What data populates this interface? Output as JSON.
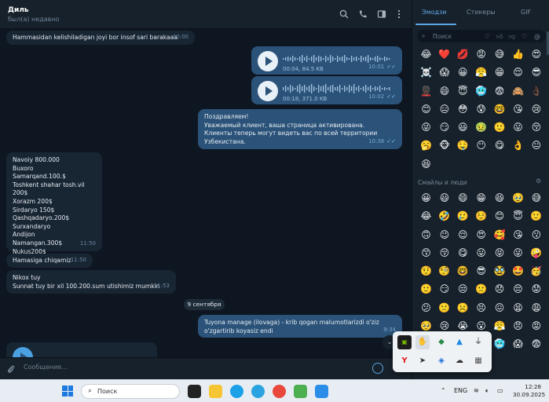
{
  "chat": {
    "name": "Диль",
    "status": "был(а) недавно",
    "composer_placeholder": "Сообщение..."
  },
  "messages": [
    {
      "text": "Hammasidan kelishiladigan joyi bor insof sari barakaaa",
      "time": "10:00"
    },
    {
      "voice_duration": "00:04, 84.5 KB",
      "time": "10:01"
    },
    {
      "voice_duration": "00:18, 371.0 KB",
      "time": "10:02"
    },
    {
      "lines": [
        "Поздравляем!",
        "Уважаемый клиент, ваша страница активирована.",
        "Клиенты теперь могут видеть вас по всей территории",
        "Узбекистана."
      ],
      "time": "10:38"
    },
    {
      "lines": [
        "Navoiy 800.000",
        "Buxoro",
        "Samarqand.100.$",
        "Toshkent shahar tosh.vil 200$",
        "Xorazm 200$",
        "Sirdaryo 150$",
        "Qashqadaryo.200$",
        "Surxandaryo",
        "Andijon",
        "Namangan.300$",
        "Nukus200$"
      ],
      "time": "11:50"
    },
    {
      "text": "Hamasiga chiqamiz",
      "time": "11:50"
    },
    {
      "lines": [
        "Nikox tuy",
        "Sunnat tuy bir xil 100.200.sum utishimiz mumkin"
      ],
      "time": "11:53"
    },
    {
      "lines": [
        "Tuyona manage (ilovaga) - krib qogan malumotlarizdi o'ziz",
        "o'zgartirib koyasiz endi"
      ],
      "time": "9:34"
    }
  ],
  "date_separator": "9 сентября",
  "emoji_panel": {
    "tabs": [
      "Эмодзи",
      "Стикеры",
      "GIF"
    ],
    "search_placeholder": "Поиск",
    "section_title": "Смайлы и люди",
    "recent": [
      "😂",
      "❤️",
      "💋",
      "😡",
      "😅",
      "👍",
      "😍",
      "☠️",
      "😱",
      "😀",
      "😤",
      "😁",
      "😌",
      "😎",
      "💂🏿",
      "😄",
      "😇",
      "🥶",
      "😨",
      "🙈",
      "👌🏿",
      "😊",
      "😑",
      "😳",
      "😰",
      "🤓",
      "😘",
      "😢",
      "😜",
      "😏",
      "😃",
      "🤢",
      "🙂",
      "😛",
      "😚",
      "🥱",
      "🐵",
      "🤤",
      "😶",
      "😋",
      "👌",
      "😐",
      "😆"
    ],
    "smileys": [
      "😀",
      "😃",
      "😄",
      "😁",
      "😆",
      "🥹",
      "😅",
      "😂",
      "🤣",
      "🥲",
      "☺️",
      "😊",
      "😇",
      "🙂",
      "🙃",
      "😉",
      "😌",
      "😍",
      "🥰",
      "😘",
      "😗",
      "😙",
      "😚",
      "😋",
      "😛",
      "😝",
      "😜",
      "🤪",
      "🤨",
      "🧐",
      "🤓",
      "😎",
      "🥸",
      "🤩",
      "🥳",
      "🙂",
      "😏",
      "😒",
      "🙁",
      "😞",
      "😔",
      "😟",
      "😕",
      "🙁",
      "☹️",
      "😣",
      "😖",
      "😫",
      "😩",
      "🥺",
      "😢",
      "😭",
      "😮",
      "😤",
      "😠",
      "😡",
      "🤬",
      "🤯",
      "😳",
      "🥵",
      "🥶",
      "😱",
      "😨",
      "😰",
      "😥"
    ]
  },
  "tray_popup": {
    "icons": [
      "nvidia-icon",
      "tray-app-icon",
      "stack-icon",
      "drive-icon",
      "usb-icon",
      "webcam-icon",
      "yandex-icon",
      "telegram-icon",
      "dropbox-icon",
      "cloud-icon",
      "media-icon"
    ]
  },
  "taskbar": {
    "search_placeholder": "Поиск",
    "lang": "ENG",
    "time": "12:28",
    "date": "30.09.2025"
  }
}
